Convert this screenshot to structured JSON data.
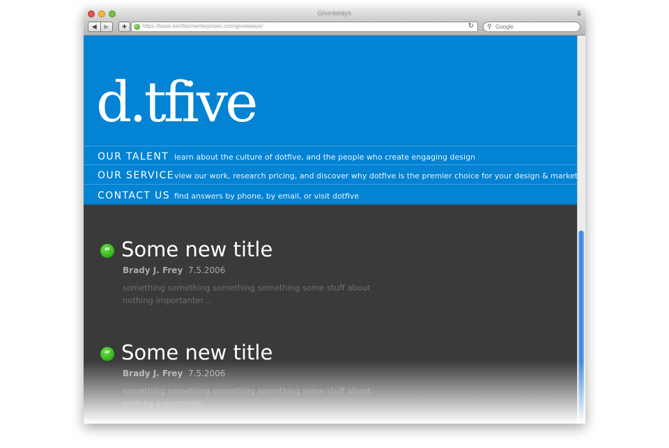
{
  "window": {
    "title": "Giveaways",
    "url": "https://base.kentfarmenterprises.com/giveaways/",
    "search_placeholder": "Google",
    "back_label": "◀",
    "forward_label": "▶",
    "add_label": "+",
    "reload_label": "↻"
  },
  "site": {
    "logo": "d.tfive",
    "brand_color": "#0383d3",
    "nav": [
      {
        "label": "OUR TALENT",
        "desc": "learn about the culture of dotfive, and the people who create engaging design"
      },
      {
        "label": "OUR SERVICE",
        "desc": "view our work, research pricing, and discover why dotfive is the premier choice for your design & marketing"
      },
      {
        "label": "CONTACT US",
        "desc": "find answers by phone, by email, or visit dotfive"
      }
    ]
  },
  "posts": [
    {
      "title": "Some new title",
      "author": "Brady J. Frey",
      "date": "7.5.2006",
      "body": "something something something something some stuff about nothing importanter..."
    },
    {
      "title": "Some new title",
      "author": "Brady J. Frey",
      "date": "7.5.2006",
      "body": "something something something something some stuff about nothing importanter..."
    }
  ],
  "icons": {
    "quote": "quote-icon",
    "glyph": "“"
  }
}
